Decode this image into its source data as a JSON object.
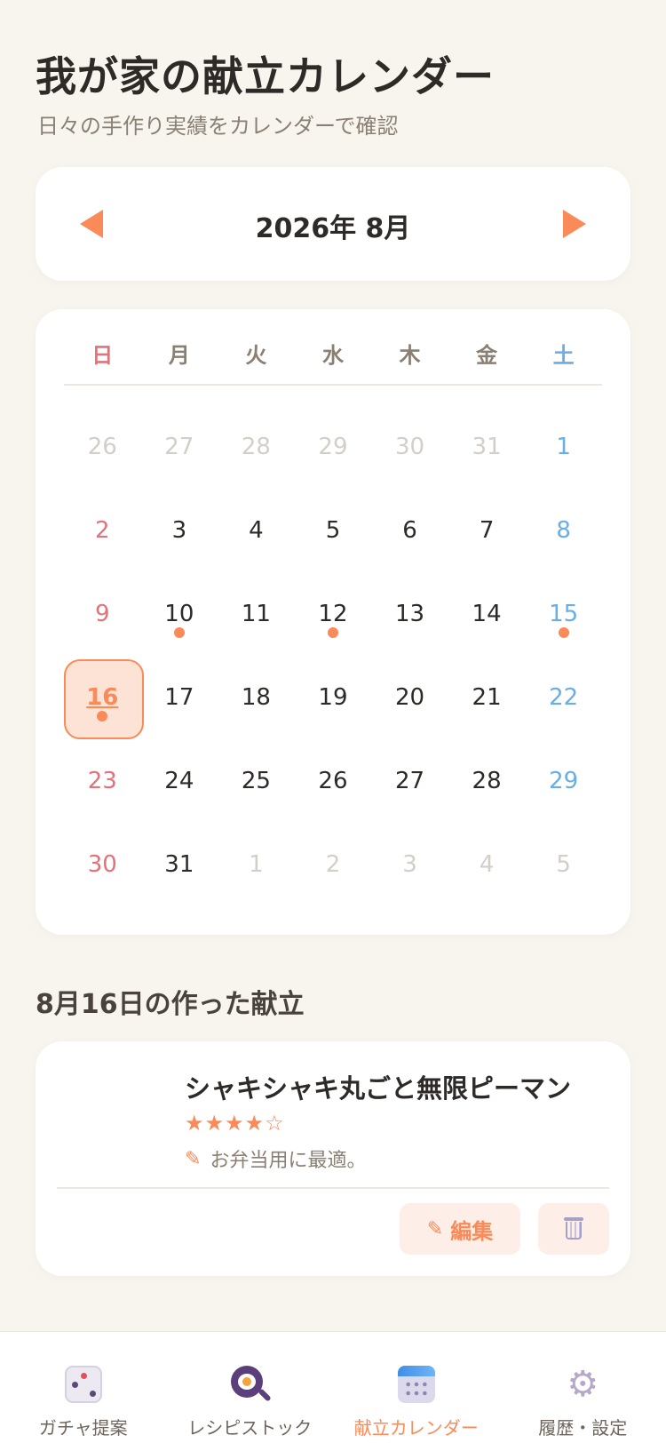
{
  "header": {
    "title": "我が家の献立カレンダー",
    "subtitle": "日々の手作り実績をカレンダーで確認"
  },
  "month_nav": {
    "label": "2026年 8月"
  },
  "calendar": {
    "weekdays": [
      "日",
      "月",
      "火",
      "水",
      "木",
      "金",
      "土"
    ],
    "days": [
      {
        "n": "26",
        "other": true
      },
      {
        "n": "27",
        "other": true
      },
      {
        "n": "28",
        "other": true
      },
      {
        "n": "29",
        "other": true
      },
      {
        "n": "30",
        "other": true
      },
      {
        "n": "31",
        "other": true
      },
      {
        "n": "1"
      },
      {
        "n": "2"
      },
      {
        "n": "3"
      },
      {
        "n": "4"
      },
      {
        "n": "5"
      },
      {
        "n": "6"
      },
      {
        "n": "7"
      },
      {
        "n": "8"
      },
      {
        "n": "9"
      },
      {
        "n": "10",
        "dot": true
      },
      {
        "n": "11"
      },
      {
        "n": "12",
        "dot": true
      },
      {
        "n": "13"
      },
      {
        "n": "14"
      },
      {
        "n": "15",
        "dot": true
      },
      {
        "n": "16",
        "dot": true,
        "selected": true
      },
      {
        "n": "17"
      },
      {
        "n": "18"
      },
      {
        "n": "19"
      },
      {
        "n": "20"
      },
      {
        "n": "21"
      },
      {
        "n": "22"
      },
      {
        "n": "23"
      },
      {
        "n": "24"
      },
      {
        "n": "25"
      },
      {
        "n": "26"
      },
      {
        "n": "27"
      },
      {
        "n": "28"
      },
      {
        "n": "29"
      },
      {
        "n": "30"
      },
      {
        "n": "31"
      },
      {
        "n": "1",
        "other": true
      },
      {
        "n": "2",
        "other": true
      },
      {
        "n": "3",
        "other": true
      },
      {
        "n": "4",
        "other": true
      },
      {
        "n": "5",
        "other": true
      }
    ]
  },
  "section": {
    "title": "8月16日の作った献立"
  },
  "meal": {
    "name": "シャキシャキ丸ごと無限ピーマン",
    "rating": 4,
    "rating_stars": "★★★★☆",
    "memo_icon": "pencil-icon",
    "memo": "お弁当用に最適。",
    "edit_label": "編集",
    "delete_icon": "trash-icon"
  },
  "tabs": [
    {
      "label": "ガチャ提案",
      "icon": "dice-icon"
    },
    {
      "label": "レシピストック",
      "icon": "frying-pan-icon"
    },
    {
      "label": "献立カレンダー",
      "icon": "calendar-icon",
      "active": true
    },
    {
      "label": "履歴・設定",
      "icon": "gear-icon"
    }
  ],
  "colors": {
    "accent": "#fa8a58",
    "sunday": "#e4727a",
    "saturday": "#6aaee6",
    "background": "#f8f5ef"
  }
}
